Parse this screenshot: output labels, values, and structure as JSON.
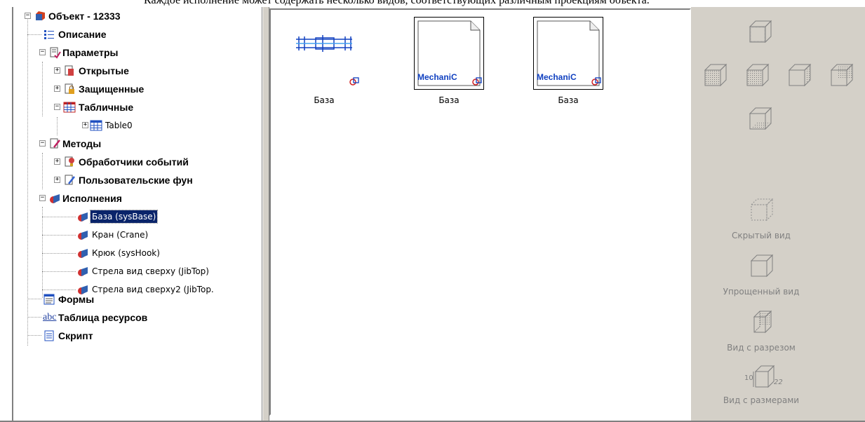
{
  "caption": "Каждое исполнение может содержать несколько видов, соответствующих различным проекциям объекта.",
  "tree": {
    "root": "Объект - 12333",
    "description": "Описание",
    "parameters": "Параметры",
    "param_open": "Открытые",
    "param_protected": "Защищенные",
    "param_table": "Табличные",
    "table0": "Table0",
    "methods": "Методы",
    "event_handlers": "Обработчики событий",
    "user_functions": "Пользовательские фун",
    "executions": "Исполнения",
    "exec_items": [
      "База (sysBase)",
      "Кран (Crane)",
      "Крюк (sysHook)",
      "Стрела вид сверху (JibTop)",
      "Стрела вид сверху2 (JibTop."
    ],
    "forms": "Формы",
    "resources": "Таблица ресурсов",
    "resources_icon_text": "abc",
    "script": "Скрипт"
  },
  "views": {
    "items": [
      {
        "label": "База",
        "thumb_text": ""
      },
      {
        "label": "База",
        "thumb_text": "MechaniC"
      },
      {
        "label": "База",
        "thumb_text": "MechaniC"
      }
    ]
  },
  "toolbar": {
    "hidden_view": "Скрытый вид",
    "simplified_view": "Упрощенный вид",
    "section_view": "Вид с разрезом",
    "dimension_view": "Вид с размерами",
    "dim_left": "10",
    "dim_right": "22"
  },
  "colors": {
    "selection": "#0a246a",
    "toolbar_bg": "#d4d0c8",
    "thumb_blue": "#1040c0",
    "marker_red": "#d02020"
  }
}
